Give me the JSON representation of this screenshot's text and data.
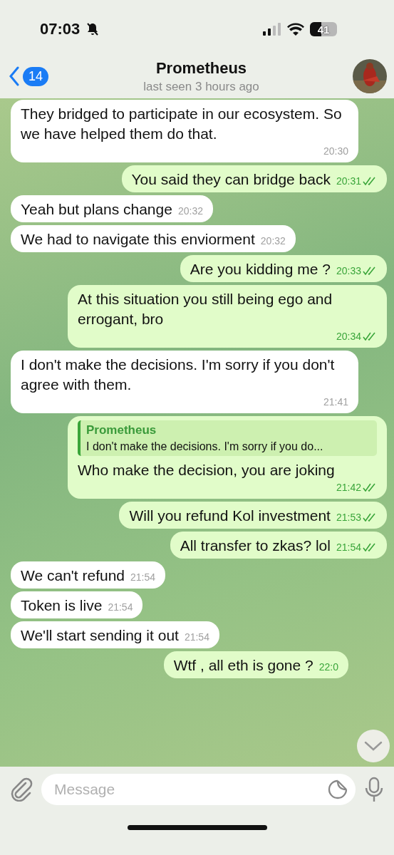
{
  "status_bar": {
    "time": "07:03",
    "battery": "41"
  },
  "header": {
    "back_count": "14",
    "title": "Prometheus",
    "subtitle": "last seen 3 hours ago"
  },
  "messages": [
    {
      "kind": "in",
      "text": "They bridged to participate in our ecosystem. So we have helped them do that.",
      "time": "20:30"
    },
    {
      "kind": "out",
      "text": "You said they can bridge back",
      "time": "20:31",
      "read": true
    },
    {
      "kind": "in",
      "text": "Yeah but plans change",
      "time": "20:32"
    },
    {
      "kind": "in",
      "text": "We had to navigate this enviorment",
      "time": "20:32"
    },
    {
      "kind": "out",
      "text": "Are you kidding me ?",
      "time": "20:33",
      "read": true
    },
    {
      "kind": "out",
      "text": "At this situation you still being ego and errogant, bro",
      "time": "20:34",
      "read": true
    },
    {
      "kind": "in",
      "text": "I don't make the decisions. I'm sorry if you don't agree with them.",
      "time": "21:41"
    },
    {
      "kind": "out",
      "reply_name": "Prometheus",
      "reply_text": "I don't make the decisions. I'm sorry if you do...",
      "text": "Who make the decision, you are joking",
      "time": "21:42",
      "read": true
    },
    {
      "kind": "out",
      "text": "Will you refund Kol investment",
      "time": "21:53",
      "read": true
    },
    {
      "kind": "out",
      "text": "All transfer to zkas? lol",
      "time": "21:54",
      "read": true
    },
    {
      "kind": "in",
      "text": "We can't refund",
      "time": "21:54"
    },
    {
      "kind": "in",
      "text": "Token is live",
      "time": "21:54"
    },
    {
      "kind": "in",
      "text": "We'll start sending it out",
      "time": "21:54"
    },
    {
      "kind": "out",
      "text": "Wtf , all eth is gone ?",
      "time": "22:0",
      "read": false
    }
  ],
  "composer": {
    "placeholder": "Message"
  }
}
